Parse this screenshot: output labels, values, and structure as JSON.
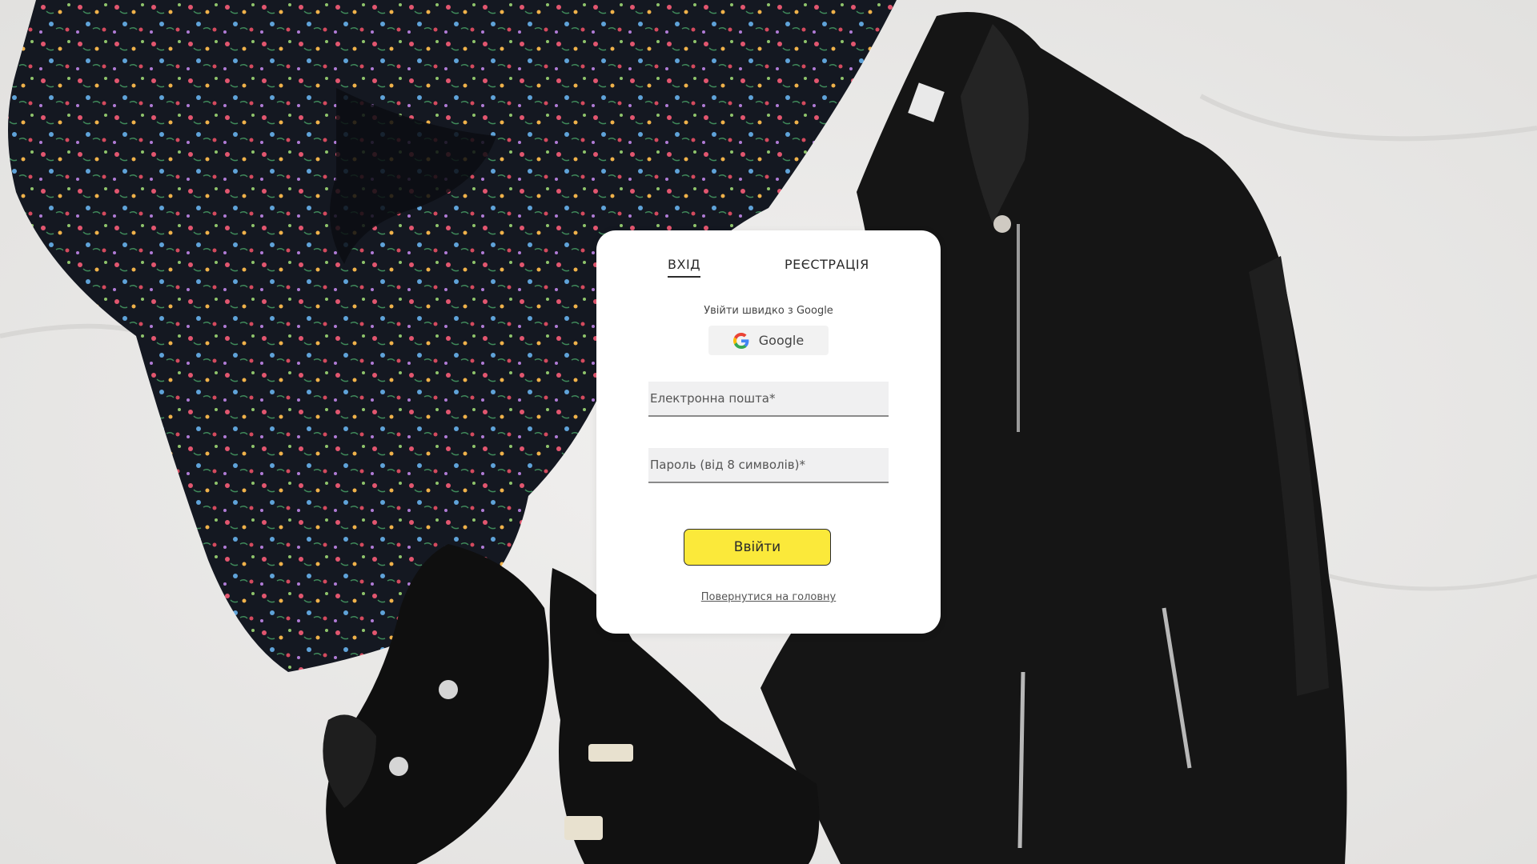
{
  "tabs": {
    "login": "ВХІД",
    "register": "РЕЄСТРАЦІЯ"
  },
  "google": {
    "hint": "Увійти швидко з Google",
    "button_label": "Google",
    "icon": "google-icon"
  },
  "form": {
    "email_placeholder": "Електронна пошта*",
    "password_placeholder": "Пароль (від 8 символів)*",
    "submit_label": "Ввійти"
  },
  "home_link": "Повернутися на головну",
  "colors": {
    "accent": "#fbe93a",
    "card": "#ffffff",
    "background": "#ecebea"
  }
}
